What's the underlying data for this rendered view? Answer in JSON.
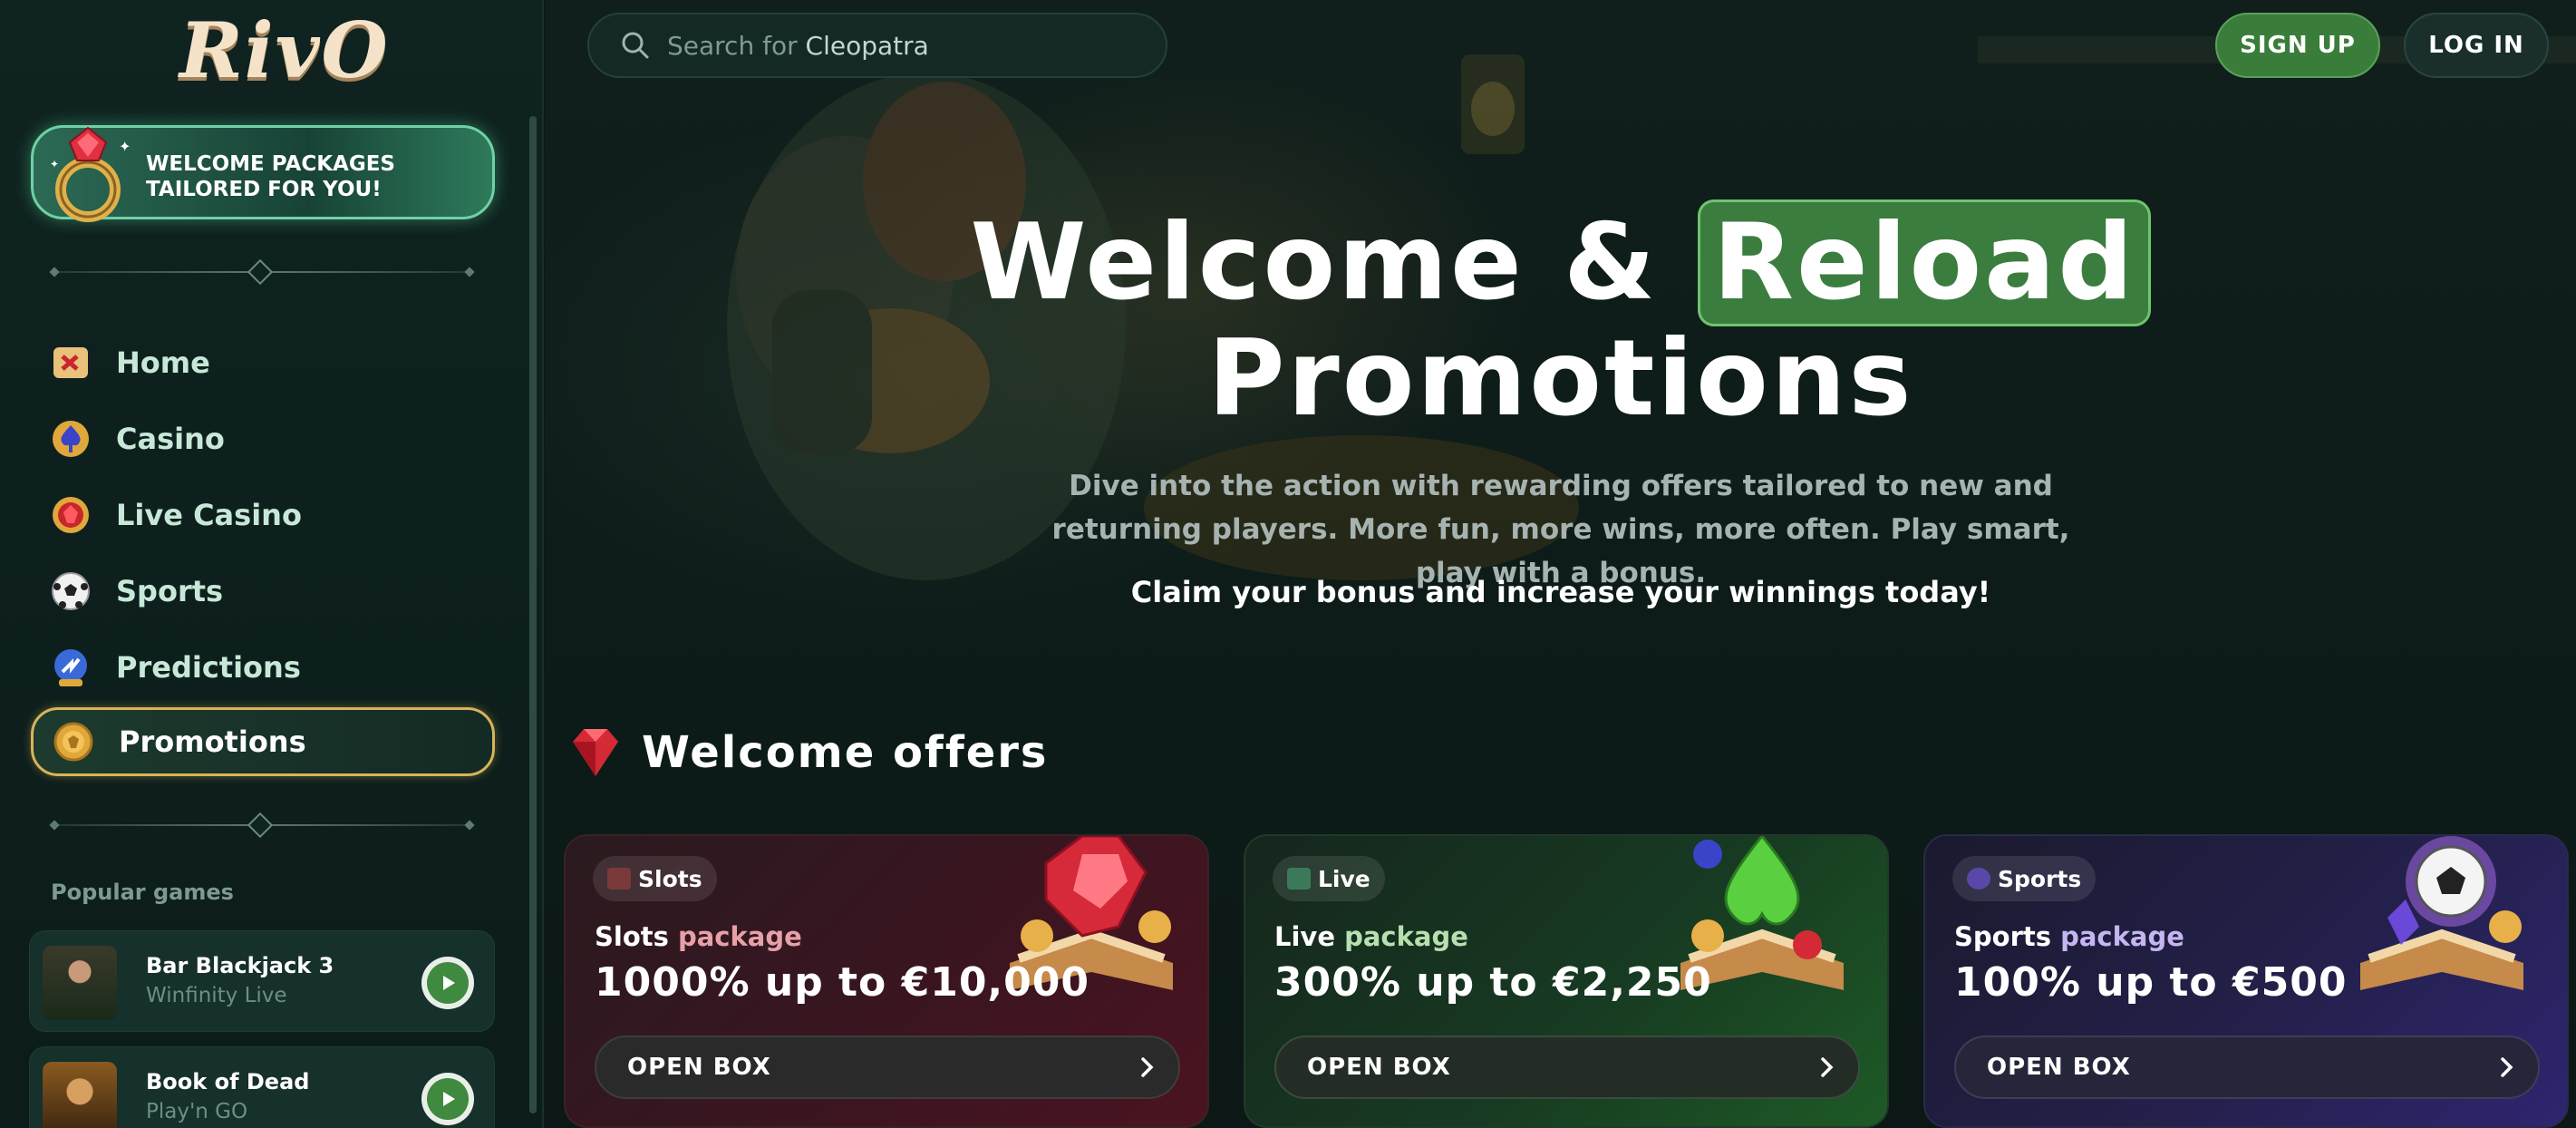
{
  "brand": {
    "logo_text": "RivO"
  },
  "sidebar": {
    "welcome_banner": "WELCOME PACKAGES TAILORED FOR YOU!",
    "items": [
      {
        "label": "Home",
        "icon": "map-scroll-icon"
      },
      {
        "label": "Casino",
        "icon": "spade-icon"
      },
      {
        "label": "Live Casino",
        "icon": "ruby-chip-icon"
      },
      {
        "label": "Sports",
        "icon": "soccer-ball-icon"
      },
      {
        "label": "Predictions",
        "icon": "crystal-ball-icon"
      },
      {
        "label": "Promotions",
        "icon": "gold-coin-icon",
        "active": true
      }
    ],
    "popular_title": "Popular games",
    "games": [
      {
        "name": "Bar Blackjack 3",
        "provider": "Winfinity Live"
      },
      {
        "name": "Book of Dead",
        "provider": "Play'n GO"
      }
    ]
  },
  "header": {
    "search_prefix": "Search for",
    "search_term": "Cleopatra",
    "signup": "SIGN UP",
    "login": "LOG IN"
  },
  "hero": {
    "title_part1": "Welcome &",
    "title_highlight": "Reload",
    "title_line2": "Promotions",
    "description": "Dive into the action with rewarding offers tailored to new and returning players. More fun, more wins, more often. Play smart, play with a bonus.",
    "claim": "Claim your bonus and increase your winnings today!"
  },
  "welcome_offers": {
    "title": "Welcome offers",
    "cards": [
      {
        "badge": "Slots",
        "package_first": "Slots",
        "package_rest": " package",
        "amount": "1000% up to €10,000",
        "cta": "OPEN BOX",
        "accent": "#e8a0a8"
      },
      {
        "badge": "Live",
        "package_first": "Live",
        "package_rest": " package",
        "amount": "300% up to €2,250",
        "cta": "OPEN BOX",
        "accent": "#b7dfb0"
      },
      {
        "badge": "Sports",
        "package_first": "Sports",
        "package_rest": " package",
        "amount": "100% up to €500",
        "cta": "OPEN BOX",
        "accent": "#c5b5f0"
      }
    ]
  },
  "colors": {
    "accent_green": "#3a7d3a",
    "gold_border": "#d7b45a",
    "background": "#0c1a18"
  }
}
